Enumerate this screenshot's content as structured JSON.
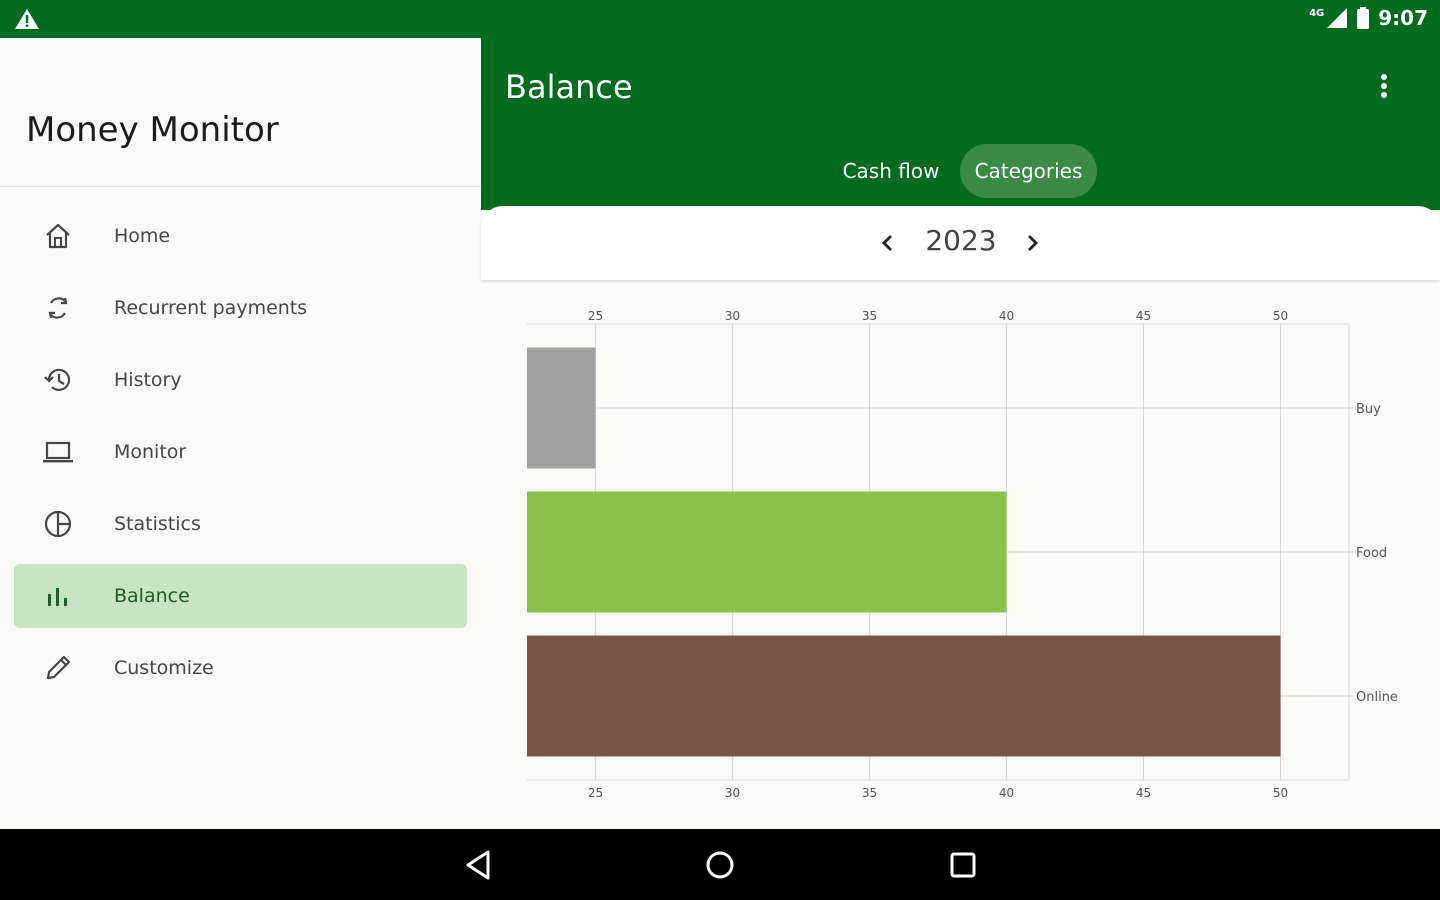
{
  "status": {
    "time": "9:07",
    "network": "4G"
  },
  "drawer": {
    "title": "Money Monitor",
    "items": [
      {
        "label": "Home",
        "icon": "home-icon"
      },
      {
        "label": "Recurrent payments",
        "icon": "sync-icon"
      },
      {
        "label": "History",
        "icon": "history-icon"
      },
      {
        "label": "Monitor",
        "icon": "laptop-icon"
      },
      {
        "label": "Statistics",
        "icon": "pie-chart-icon"
      },
      {
        "label": "Balance",
        "icon": "bar-chart-icon",
        "active": true
      },
      {
        "label": "Customize",
        "icon": "pencil-icon"
      }
    ]
  },
  "appbar": {
    "title": "Balance",
    "tabs": [
      {
        "label": "Cash flow",
        "active": false
      },
      {
        "label": "Categories",
        "active": true
      }
    ]
  },
  "year_selector": {
    "value": "2023"
  },
  "chart_data": {
    "type": "bar",
    "orientation": "horizontal",
    "categories": [
      "Buy",
      "Food",
      "Online"
    ],
    "values": [
      25,
      40,
      50
    ],
    "colors": [
      "#a0a0a0",
      "#8bc34a",
      "#795548"
    ],
    "xlim": [
      22.5,
      52.5
    ],
    "xticks": [
      25,
      30,
      35,
      40,
      45,
      50
    ],
    "grid": true
  },
  "colors": {
    "primary": "#026b1e",
    "drawer_active": "#c9e4c5",
    "tab_active": "#3b8a45"
  }
}
